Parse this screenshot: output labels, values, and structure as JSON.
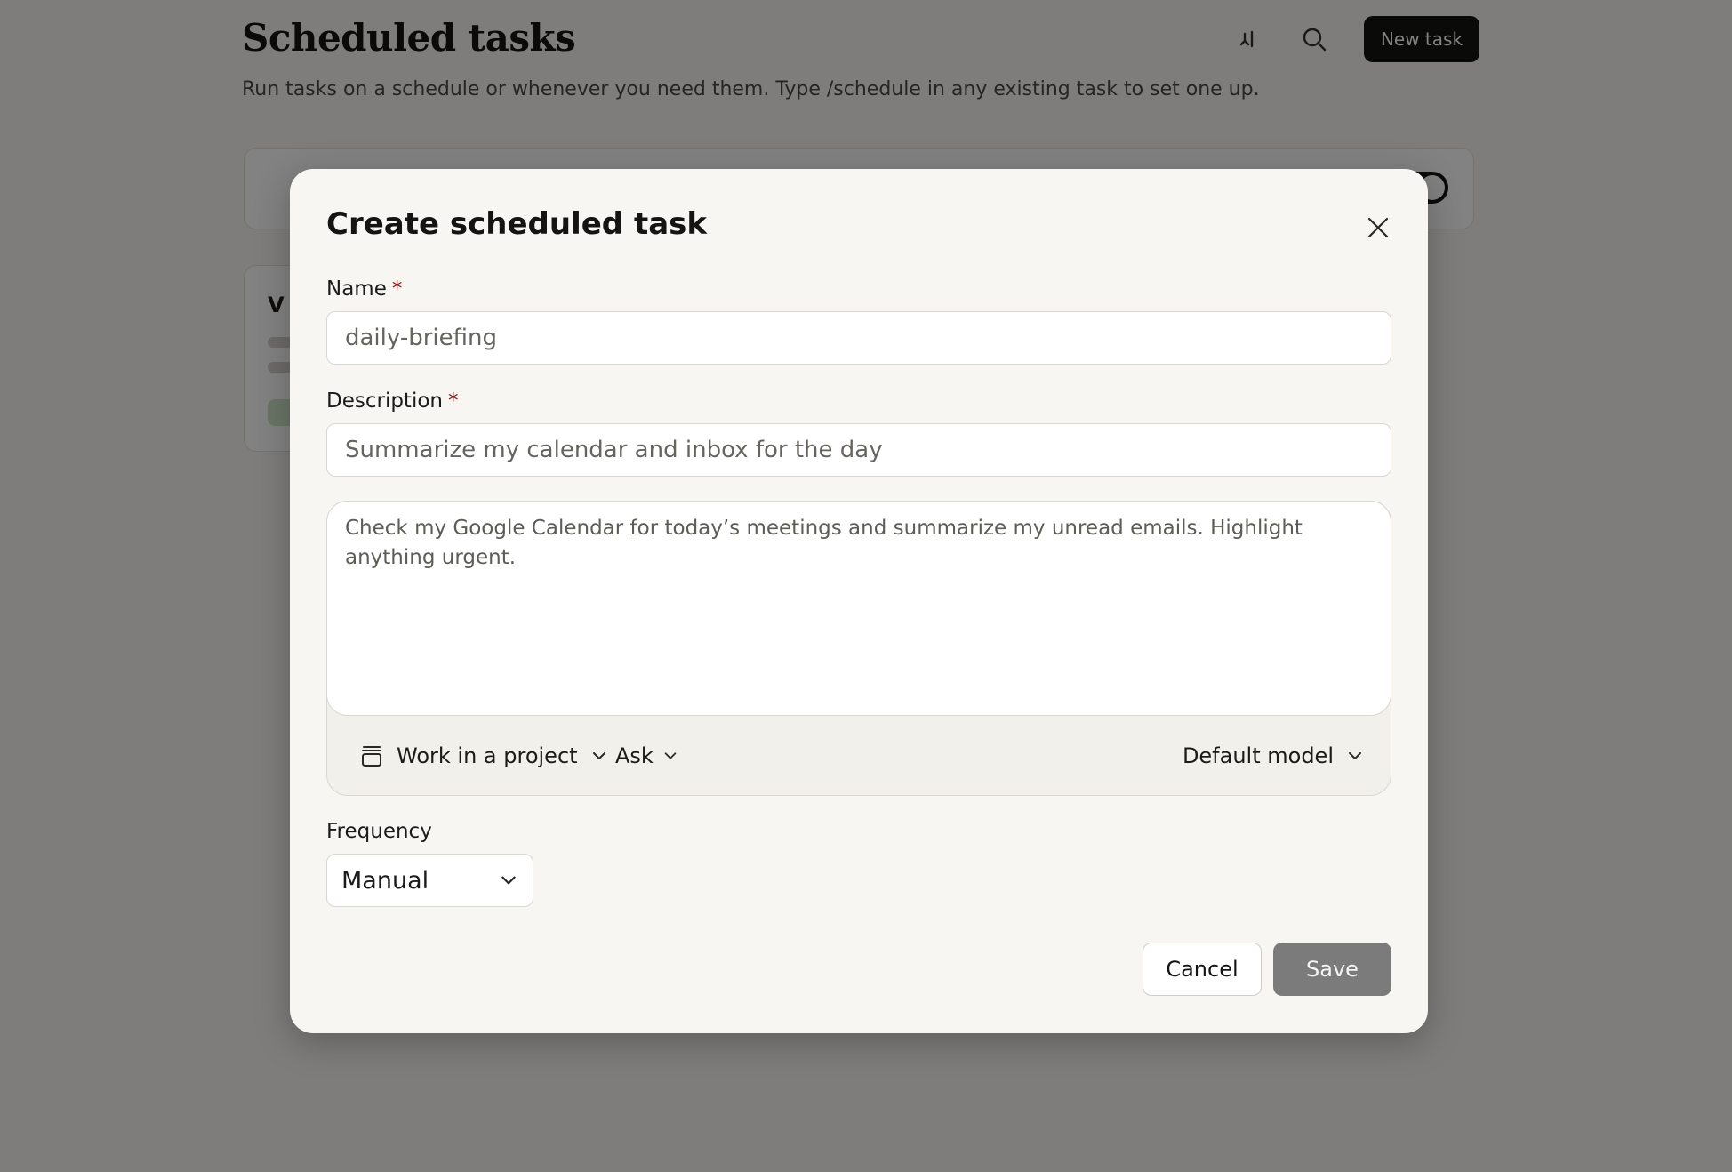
{
  "background_page": {
    "title": "Scheduled tasks",
    "subtitle": "Run tasks on a schedule or whenever you need them. Type /schedule in any existing task to set one up.",
    "new_task_label": "New task",
    "card_title_fragment": "V",
    "icons": [
      "sort-icon",
      "search-icon"
    ]
  },
  "modal": {
    "title": "Create scheduled task",
    "close_icon": "close-icon",
    "name": {
      "label": "Name",
      "required_mark": "*",
      "value": "daily-briefing"
    },
    "description": {
      "label": "Description",
      "required_mark": "*",
      "value": "Summarize my calendar and inbox for the day"
    },
    "prompt": {
      "value": "Check my Google Calendar for today’s meetings and summarize my unread emails. Highlight anything urgent."
    },
    "toolbar": {
      "project_label": "Work in a project",
      "project_icon": "folder-icon",
      "permission_label": "Ask",
      "model_label": "Default model"
    },
    "frequency": {
      "label": "Frequency",
      "selected": "Manual"
    },
    "buttons": {
      "cancel": "Cancel",
      "save": "Save"
    }
  },
  "colors": {
    "modal_bg": "#f7f6f2",
    "overlay": "#000000",
    "required": "#8a1a1a",
    "save_disabled": "#7b7b7b"
  }
}
